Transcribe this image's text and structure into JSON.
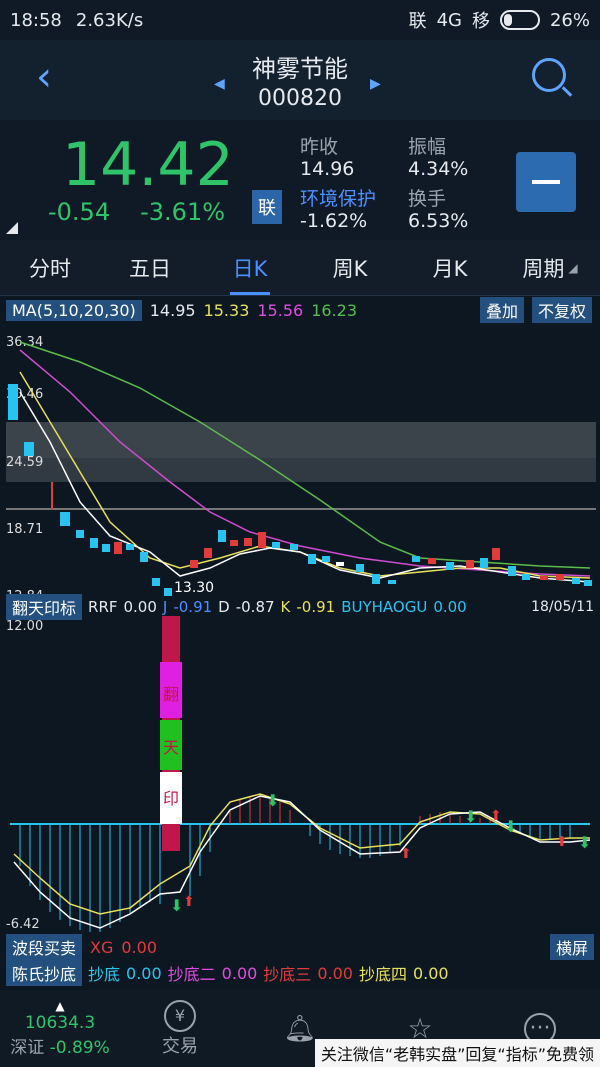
{
  "statusbar": {
    "time": "18:58",
    "speed": "2.63K/s",
    "carrier1": "联",
    "net": "4G",
    "carrier2": "移",
    "battery": "26%",
    "battery_level": 0.26
  },
  "header": {
    "name": "神雾节能",
    "code": "000820"
  },
  "quote": {
    "price": "14.42",
    "change": "-0.54",
    "change_pct": "-3.61%",
    "tag": "联",
    "stats": {
      "prev_close_label": "昨收",
      "prev_close": "14.96",
      "amplitude_label": "振幅",
      "amplitude": "4.34%",
      "sector_label": "环境保护",
      "sector_value": "-1.62%",
      "turnover_label": "换手",
      "turnover": "6.53%"
    }
  },
  "tabs": [
    "分时",
    "五日",
    "日K",
    "周K",
    "月K",
    "周期"
  ],
  "ma": {
    "label": "MA(5,10,20,30)",
    "v1": "14.95",
    "v2": "15.33",
    "v3": "15.56",
    "v4": "16.23",
    "overlay": "叠加",
    "adjust": "不复权"
  },
  "axis": {
    "y_top": "36.34",
    "y_2": "30.46",
    "y_3": "24.59",
    "y_4": "18.71",
    "y_bottom": "12.84",
    "low_label": "13.30",
    "date": "18/05/11"
  },
  "indicator1": {
    "name": "翻天印标",
    "rrf": "RRF",
    "rrf_val": "0.00",
    "j": "J",
    "j_val": "-0.91",
    "d": "D",
    "d_val": "-0.87",
    "k": "K",
    "k_val": "-0.91",
    "buy": "BUYHAOGU",
    "buy_val": "0.00",
    "y_top": "12.00",
    "y_bottom": "-6.42",
    "chars": [
      "翻",
      "天",
      "印"
    ]
  },
  "indicator2": {
    "name": "波段买卖",
    "xg": "XG",
    "xg_val": "0.00",
    "landscape": "横屏"
  },
  "indicator3": {
    "name": "陈氏抄底",
    "c1": "抄底",
    "c1v": "0.00",
    "c2": "抄底二",
    "c2v": "0.00",
    "c3": "抄底三",
    "c3v": "0.00",
    "c4": "抄底四",
    "c4v": "0.00"
  },
  "footer": {
    "index_value": "10634.3",
    "index_name": "深证",
    "index_change": "-0.89%",
    "trade": "交易",
    "watermark": "关注微信“老韩实盘”回复“指标”免费领"
  },
  "colors": {
    "up": "#e23b3b",
    "down": "#2fc36a",
    "accent": "#4a90ff"
  }
}
